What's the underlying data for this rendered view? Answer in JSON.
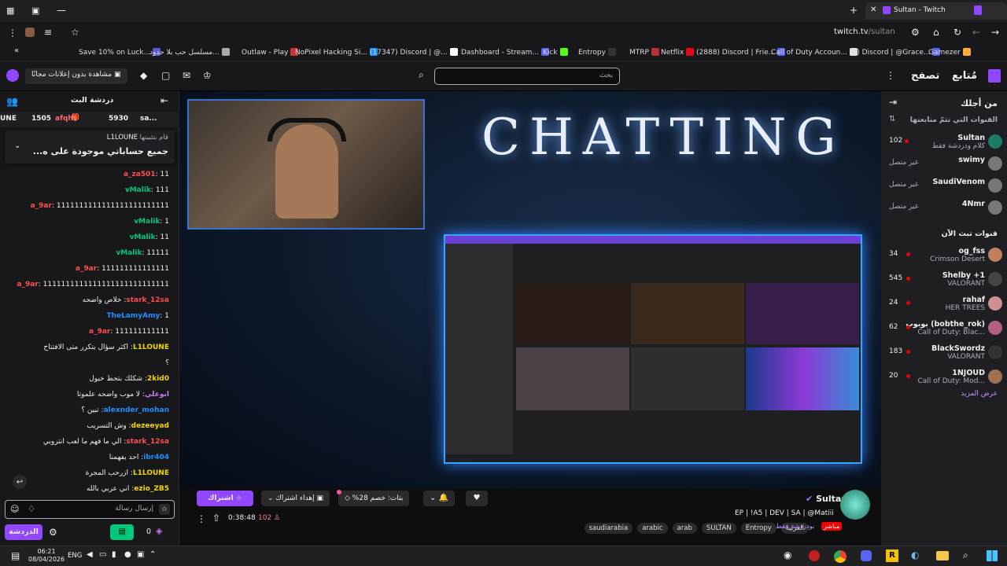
{
  "browser": {
    "tab_title": "Sultan - Twitch",
    "url_host": "twitch.tv",
    "url_path": "/sultan",
    "bookmarks": [
      {
        "label": "Save 10% on Luck...",
        "color": "#5b5bd6"
      },
      {
        "label": "مسلسل حب بلا حدود...",
        "color": "#aaaaaa"
      },
      {
        "label": "Outlaw - Play",
        "color": "#cc3333"
      },
      {
        "label": "NoPixel Hacking Si...",
        "color": "#1e90ff"
      },
      {
        "label": "(17347) Discord | @...",
        "color": "#ffffff"
      },
      {
        "label": "Dashboard - Stream...",
        "color": "#5865f2"
      },
      {
        "label": "Kick",
        "color": "#53fc18"
      },
      {
        "label": "Entropy",
        "color": "#333333"
      },
      {
        "label": "MTRP",
        "color": "#b33333"
      },
      {
        "label": "Netflix",
        "color": "#e50914"
      },
      {
        "label": "(2888) Discord | Frie...",
        "color": "#5865f2"
      },
      {
        "label": "Call of Duty Accoun...",
        "color": "#e0e0e0"
      },
      {
        "label": "(1) Discord | @Grace...",
        "color": "#5865f2"
      },
      {
        "label": "Gamezer",
        "color": "#ffaa33"
      }
    ]
  },
  "topnav": {
    "search_placeholder": "بحث",
    "following": "مُتابع",
    "browse": "تصفح",
    "ad_free": "مشاهدة بدون إعلانات مجانًا"
  },
  "chat": {
    "title": "دردشة البث",
    "gift_bar": [
      "1505",
      "5930",
      "afqht",
      "sa...",
      "UNE"
    ],
    "pinned_user": "L1LOUNE",
    "pinned_by": "قام بتثبيتها",
    "pinned_text": "جميع حساباتي موجودة على ه...",
    "messages": [
      {
        "user": "a_za501",
        "text": "11",
        "color": "#ff4f4f"
      },
      {
        "user": "vMalik",
        "text": "111",
        "color": "#00c87a"
      },
      {
        "user": "a_9ar",
        "text": "1111111111111111111111111",
        "color": "#ff4f4f"
      },
      {
        "user": "vMalik",
        "text": "1",
        "color": "#00c87a"
      },
      {
        "user": "vMalik",
        "text": "11",
        "color": "#00c87a"
      },
      {
        "user": "vMalik",
        "text": "11111",
        "color": "#00c87a"
      },
      {
        "user": "a_9ar",
        "text": "111111111111111",
        "color": "#ff4f4f"
      },
      {
        "user": "a_9ar",
        "text": "1111111111111111111111111111",
        "color": "#ff4f4f"
      },
      {
        "user": "stark_12sa",
        "text": "خلاص واضحه",
        "color": "#ff4f4f"
      },
      {
        "user": "TheLamyAmy",
        "text": "1",
        "color": "#1e90ff"
      },
      {
        "user": "a_9ar",
        "text": "111111111111",
        "color": "#ff4f4f"
      },
      {
        "user": "L1LOUNE",
        "text": "اكثر سؤال يتكرر متى الافتتاح",
        "color": "#f2d600"
      },
      {
        "user": "",
        "text": "؟",
        "color": "#efeff1"
      },
      {
        "user": "2kid0",
        "text": "شكلك بتحط خيول",
        "color": "#f2d600"
      },
      {
        "user": "ابوعلي",
        "text": "لا موب واضحه علموتا",
        "color": "#c07cf0"
      },
      {
        "user": "alexnder_mohan",
        "text": "تبين ؟",
        "color": "#1e90ff"
      },
      {
        "user": "dezeeyad",
        "text": "وش التسريب",
        "color": "#f2d600"
      },
      {
        "user": "stark_12sa",
        "text": "الي ما فهم ما لعب انتروبي",
        "color": "#ff4f4f"
      },
      {
        "user": "ibr404",
        "text": "احد يفهمنا",
        "color": "#1e90ff"
      },
      {
        "user": "L1LOUNE",
        "text": "ازرحب المجرة",
        "color": "#f2d600"
      },
      {
        "user": "ezio_ZB5",
        "text": "اني عربي بالله",
        "color": "#f2d600"
      }
    ],
    "input_placeholder": "إرسال رسالة",
    "send_label": "الدردشة",
    "points": "0"
  },
  "stream": {
    "overlay_title": "CHATTING",
    "subscribe_label": "اشتراك",
    "gift_sub_label": "إهداء اشتراك",
    "discount_label": "بتات: خصم 28%",
    "channel_name": "Sultan",
    "stream_title": "EP | !A5 | DEV | SA | @Matiii",
    "live_badge": "مباشر",
    "category": "بودردشة فقط",
    "uptime": "0:38:48",
    "viewers": "102",
    "tags": [
      "العربية",
      "Entropy",
      "SULTAN",
      "arab",
      "arabic",
      "saudiarabia"
    ]
  },
  "sidebar": {
    "for_you": "من أجلك",
    "followed_header": "القنوات التي تتمّ متابعتها",
    "followed": [
      {
        "name": "Sultan",
        "game": "كلام ودردشة فقط",
        "viewers": "102",
        "live": true
      },
      {
        "name": "swimy",
        "game": "",
        "viewers": "غير متصل",
        "live": false
      },
      {
        "name": "SaudiVenom",
        "game": "",
        "viewers": "غير متصل",
        "live": false
      },
      {
        "name": "4Nmr",
        "game": "",
        "viewers": "غير متصل",
        "live": false
      }
    ],
    "live_header": "قنوات تبث الآن",
    "live": [
      {
        "name": "og_fss",
        "game": "Crimson Desert",
        "viewers": "34"
      },
      {
        "name": "Shelby +1",
        "game": "VALORANT",
        "viewers": "545"
      },
      {
        "name": "rahaf",
        "game": "HER TREES",
        "viewers": "24"
      },
      {
        "name": "بوبوب (bobthe_rok)",
        "game": "Call of Duty: Blac...",
        "viewers": "62"
      },
      {
        "name": "BlackSwordz",
        "game": "VALORANT",
        "viewers": "183"
      },
      {
        "name": "1NJOUD",
        "game": "Call of Duty: Mod...",
        "viewers": "20"
      }
    ],
    "show_more": "عرض المزيد"
  },
  "taskbar": {
    "time": "06:21",
    "date": "08/04/2026",
    "lang": "ENG"
  },
  "colors": {
    "twitch_purple": "#9147ff",
    "live_red": "#eb0400"
  }
}
